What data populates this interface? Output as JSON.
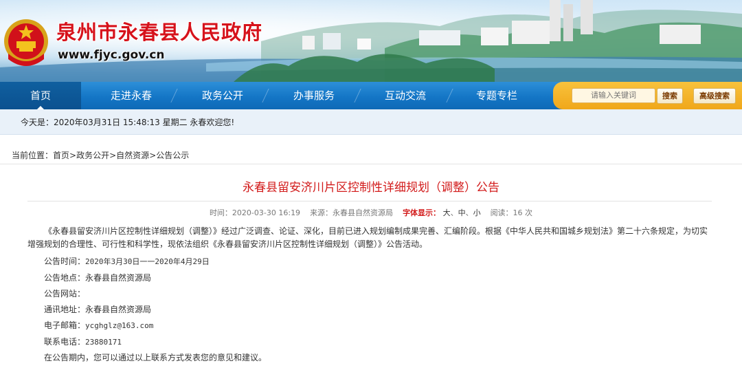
{
  "header": {
    "site_title": "泉州市永春县人民政府",
    "site_url": "www.fjyc.gov.cn",
    "emblem_icon": "national-emblem-icon"
  },
  "nav": {
    "items": [
      {
        "label": "首页",
        "active": true
      },
      {
        "label": "走进永春"
      },
      {
        "label": "政务公开"
      },
      {
        "label": "办事服务"
      },
      {
        "label": "互动交流"
      },
      {
        "label": "专题专栏"
      }
    ],
    "search_placeholder": "请输入关键词",
    "search_button": "搜索",
    "advanced_search_button": "高级搜索"
  },
  "datebar": {
    "text": "今天是：2020年03月31日 15:48:13 星期二  永春欢迎您!"
  },
  "breadcrumb": {
    "prefix": "当前位置：",
    "items": [
      "首页",
      "政务公开",
      "自然资源",
      "公告公示"
    ],
    "separator": ">"
  },
  "article": {
    "title": "永春县留安济川片区控制性详细规划（调整）公告",
    "meta": {
      "time": "时间：2020-03-30 16:19",
      "source": "来源：永春县自然资源局",
      "font_label": "字体显示：",
      "font_large": "大",
      "font_medium": "中",
      "font_small": "小",
      "reads": "阅读：16 次"
    },
    "paragraph": "《永春县留安济川片区控制性详细规划（调整）》经过广泛调查、论证、深化，目前已进入规划编制成果完善、汇编阶段。根据《中华人民共和国城乡规划法》第二十六条规定，为切实增强规划的合理性、可行性和科学性，现依法组织《永春县留安济川片区控制性详细规划（调整）》公告活动。",
    "announce_time_label": "公告时间：",
    "announce_time": "2020年3月30日一一2020年4月29日",
    "place_label": "公告地点：",
    "place": "永春县自然资源局",
    "website_label": "公告网站：",
    "website": "",
    "address_label": "通讯地址：",
    "address": "永春县自然资源局",
    "email_label": "电子邮箱：",
    "email": "ycghglz@163.com",
    "phone_label": "联系电话：",
    "phone": "23880171",
    "closing": "在公告期内，您可以通过以上联系方式发表您的意见和建议。"
  },
  "colors": {
    "title_red": "#d6121b",
    "nav_blue": "#1476c6",
    "search_orange": "#f0a71a",
    "datebar_bg": "#e9f1f9"
  }
}
